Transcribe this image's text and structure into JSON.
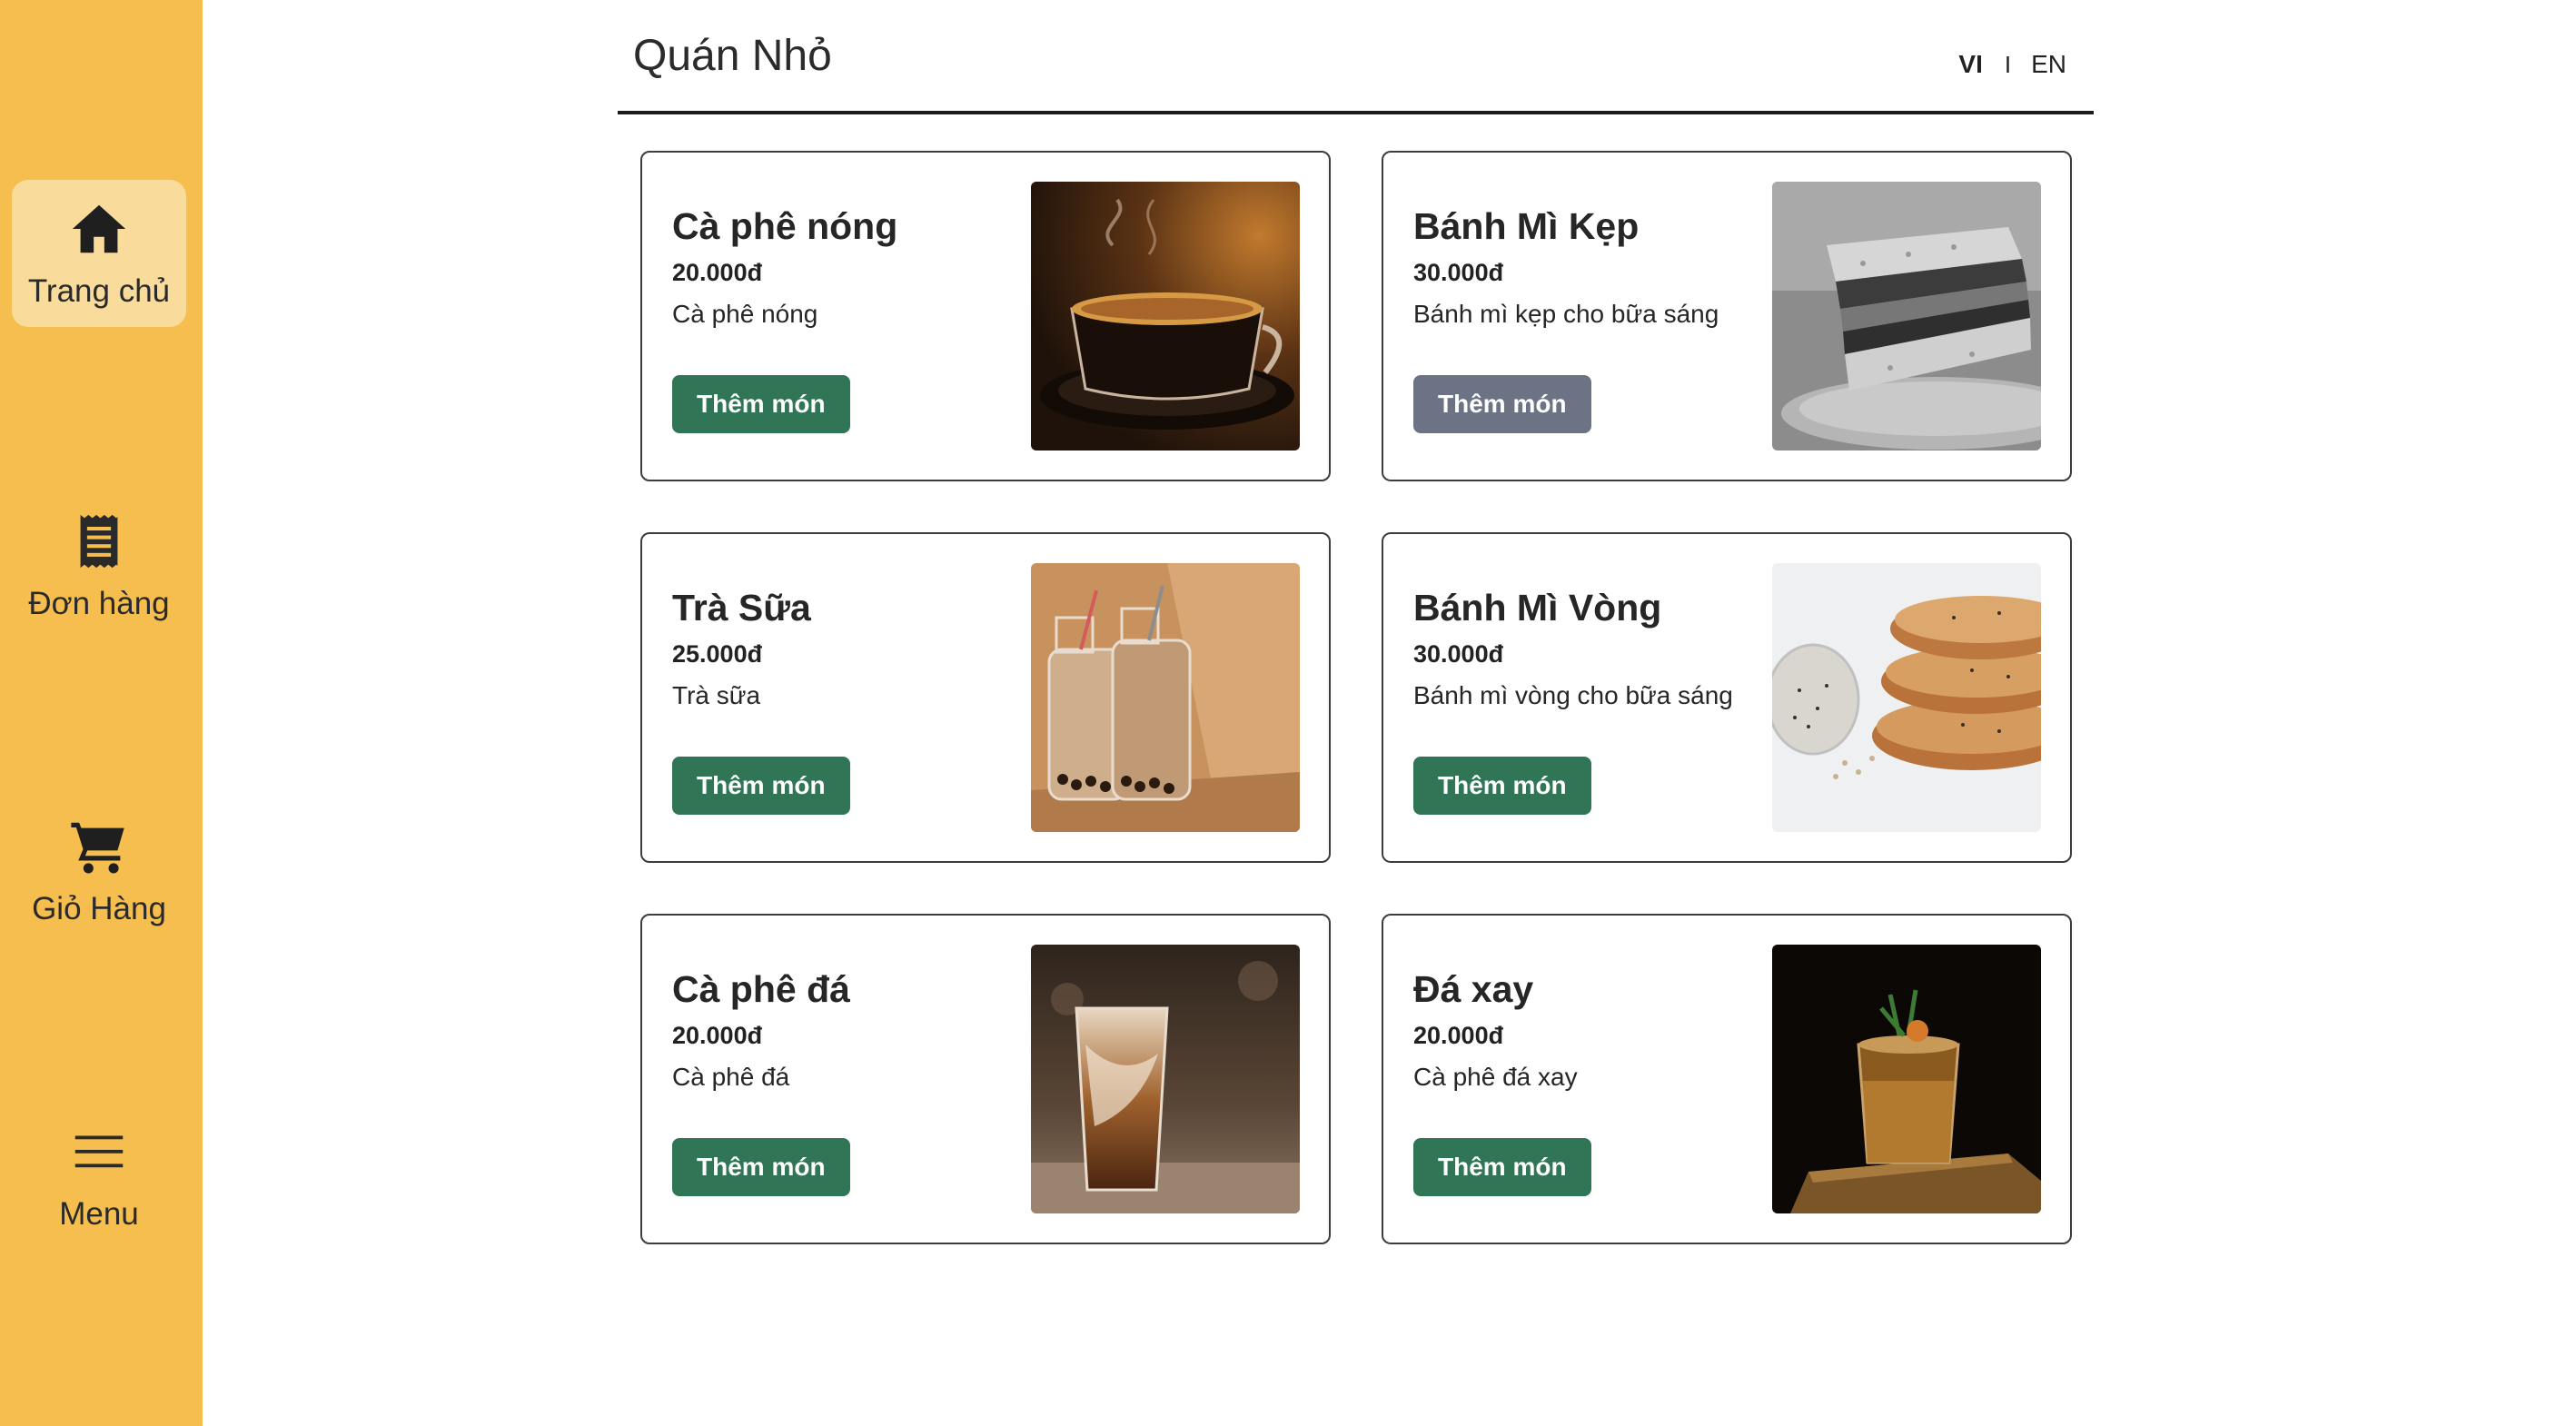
{
  "sidebar": {
    "items": [
      {
        "label": "Trang chủ",
        "icon": "home-icon",
        "active": true
      },
      {
        "label": "Đơn hàng",
        "icon": "receipt-icon",
        "active": false
      },
      {
        "label": "Giỏ Hàng",
        "icon": "cart-icon",
        "active": false
      },
      {
        "label": "Menu",
        "icon": "menu-icon",
        "active": false
      }
    ]
  },
  "header": {
    "title": "Quán Nhỏ",
    "lang_vi": "VI",
    "lang_sep": "I",
    "lang_en": "EN",
    "active_lang": "VI"
  },
  "products": [
    {
      "name": "Cà phê nóng",
      "price": "20.000đ",
      "description": "Cà phê nóng",
      "button": "Thêm món",
      "button_enabled": true
    },
    {
      "name": "Bánh Mì Kẹp",
      "price": "30.000đ",
      "description": "Bánh mì kẹp cho bữa sáng",
      "button": "Thêm món",
      "button_enabled": false
    },
    {
      "name": "Trà Sữa",
      "price": "25.000đ",
      "description": "Trà sữa",
      "button": "Thêm món",
      "button_enabled": true
    },
    {
      "name": "Bánh Mì Vòng",
      "price": "30.000đ",
      "description": "Bánh mì vòng cho bữa sáng",
      "button": "Thêm món",
      "button_enabled": true
    },
    {
      "name": "Cà phê đá",
      "price": "20.000đ",
      "description": "Cà phê đá",
      "button": "Thêm món",
      "button_enabled": true
    },
    {
      "name": "Đá xay",
      "price": "20.000đ",
      "description": "Cà phê đá xay",
      "button": "Thêm món",
      "button_enabled": true
    }
  ],
  "colors": {
    "sidebar_bg": "#f5be4e",
    "sidebar_active_bg": "#f9dc9c",
    "button_green": "#2f7556",
    "button_disabled": "#6b7385"
  }
}
